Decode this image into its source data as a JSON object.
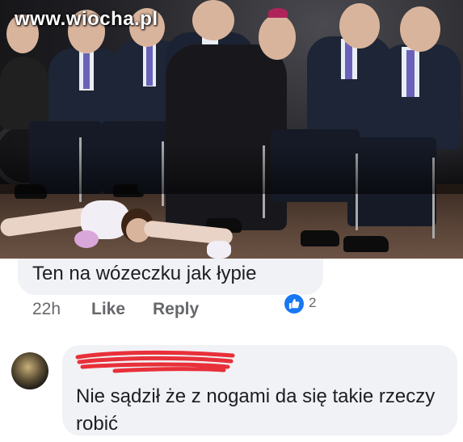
{
  "photo": {
    "watermark": "www.wiocha.pl"
  },
  "comments": [
    {
      "text": "Ten na wózeczku jak łypie",
      "time": "22h",
      "like_label": "Like",
      "reply_label": "Reply",
      "reaction_icon": "thumbs-up-icon",
      "reaction_count": "2",
      "reaction_color": "#1877f2"
    },
    {
      "author_redacted": true,
      "text": "Nie sądził że z nogami da się takie rzeczy robić"
    }
  ],
  "colors": {
    "bubble": "#f0f2f5",
    "text": "#1c1e21",
    "meta": "#65676b",
    "redaction": "#e8303a"
  }
}
